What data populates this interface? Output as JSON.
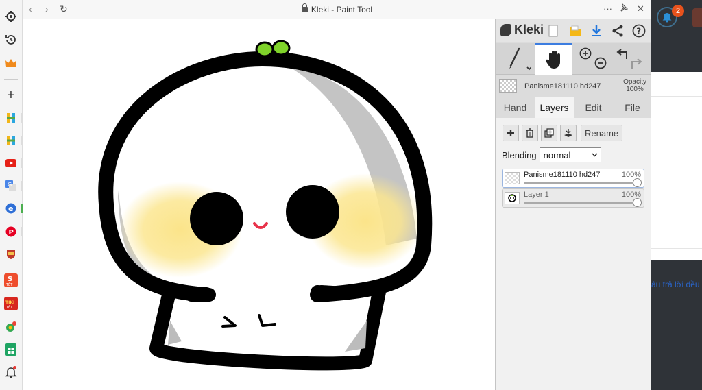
{
  "window": {
    "title": "Kleki - Paint Tool",
    "nav_back": "‹",
    "nav_forward": "›",
    "reload": "↻",
    "menu": "···",
    "pin": "✧",
    "close": "✕"
  },
  "sidebar": {
    "items": [
      {
        "icon": "settings-icon",
        "glyph": "⚙"
      },
      {
        "icon": "history-icon",
        "glyph": "↺"
      },
      {
        "icon": "crown-icon",
        "glyph": "♛"
      },
      {
        "icon": "add-icon",
        "glyph": "+"
      },
      {
        "icon": "h-app-icon",
        "glyph": "H"
      },
      {
        "icon": "h-app-icon",
        "glyph": "H"
      },
      {
        "icon": "youtube-icon",
        "glyph": "▶"
      },
      {
        "icon": "translate-icon",
        "glyph": "G"
      },
      {
        "icon": "app-icon",
        "glyph": "e"
      },
      {
        "icon": "pinterest-icon",
        "glyph": "P"
      },
      {
        "icon": "shield-icon",
        "glyph": "✠"
      },
      {
        "icon": "shop-icon",
        "glyph": "S"
      },
      {
        "icon": "tiki-icon",
        "glyph": "T"
      },
      {
        "icon": "maps-icon",
        "glyph": "◉"
      },
      {
        "icon": "sheet-icon",
        "glyph": "▦"
      },
      {
        "icon": "notification-icon",
        "glyph": "🔔"
      }
    ],
    "shop_label": "TẾT",
    "tiki_label": "TIKI"
  },
  "kleki": {
    "logo": "Kleki",
    "layer_name": "Panisme181110 hd247",
    "opacity_label": "Opacity",
    "opacity_value": "100%",
    "tabs": [
      {
        "label": "Hand"
      },
      {
        "label": "Layers"
      },
      {
        "label": "Edit"
      },
      {
        "label": "File"
      }
    ],
    "rename_label": "Rename",
    "blending_label": "Blending",
    "blending_value": "normal",
    "layers": [
      {
        "name": "Panisme181110 hd247",
        "opacity": "100%",
        "opacity_value": 1.0
      },
      {
        "name": "Layer 1",
        "opacity": "100%",
        "opacity_value": 1.0
      }
    ]
  },
  "right_page": {
    "notification_count": "2",
    "link_text": "âu trả lời đều"
  }
}
